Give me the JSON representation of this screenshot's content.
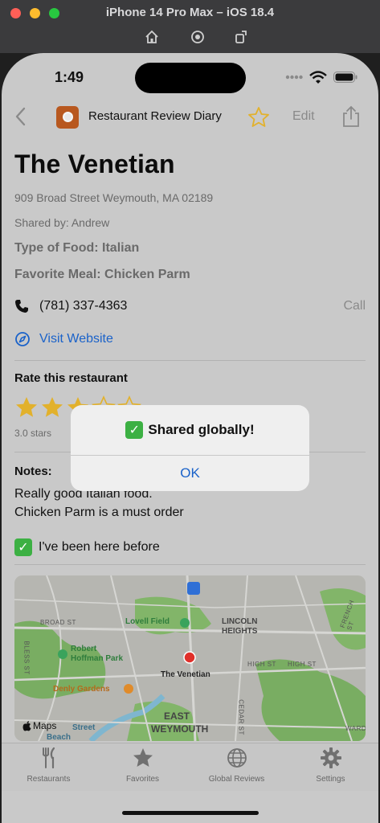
{
  "simulator": {
    "title": "iPhone 14 Pro Max – iOS 18.4"
  },
  "status": {
    "time": "1:49"
  },
  "nav": {
    "title": "Restaurant Review Diary",
    "edit": "Edit"
  },
  "restaurant": {
    "name": "The Venetian",
    "address": "909 Broad Street Weymouth, MA 02189",
    "shared_by": "Shared by: Andrew",
    "food_type": "Type of Food: Italian",
    "favorite_meal": "Favorite Meal: Chicken Parm",
    "phone": "(781) 337-4363",
    "call": "Call",
    "website": "Visit Website"
  },
  "rating": {
    "title": "Rate this restaurant",
    "value": 3,
    "max": 5,
    "label": "3.0 stars"
  },
  "notes": {
    "title": "Notes:",
    "lines": [
      "Really good Italian food.",
      "Chicken Parm is a must order"
    ],
    "visited": "I've been here before"
  },
  "map": {
    "pin": "The Venetian",
    "places": [
      "Lovell Field",
      "LINCOLN",
      "HEIGHTS",
      "Robert",
      "Hoffman Park",
      "Denly Gardens",
      "EAST",
      "WEYMOUTH",
      "Street",
      "Beach"
    ],
    "roads": [
      "BROAD ST",
      "HIGH ST",
      "HIGH ST",
      "FRENCH ST",
      "CEDAR ST",
      "BLESS ST",
      "WARD"
    ],
    "attribution": "Maps"
  },
  "alert": {
    "title": "Shared globally!",
    "ok": "OK"
  },
  "tabs": [
    {
      "label": "Restaurants"
    },
    {
      "label": "Favorites"
    },
    {
      "label": "Global Reviews"
    },
    {
      "label": "Settings"
    }
  ],
  "colors": {
    "accent": "#1a62c9",
    "star": "#e2b12c",
    "check": "#3cb043",
    "logo": "#b8581f",
    "pin": "#e0302a"
  }
}
